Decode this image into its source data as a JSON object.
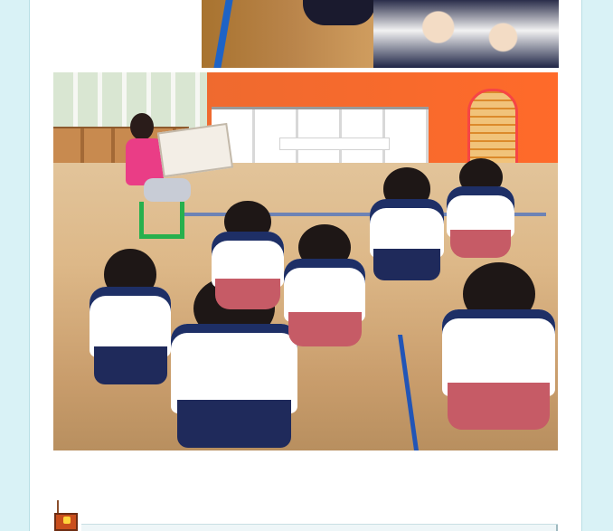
{
  "page": {
    "background_color": "#d9f2f6"
  },
  "top_photo": {
    "icon": "classroom-photo-icon"
  },
  "main_photo": {
    "icon": "storytime-photo-icon"
  },
  "footer": {
    "icon": "bell-icon"
  }
}
